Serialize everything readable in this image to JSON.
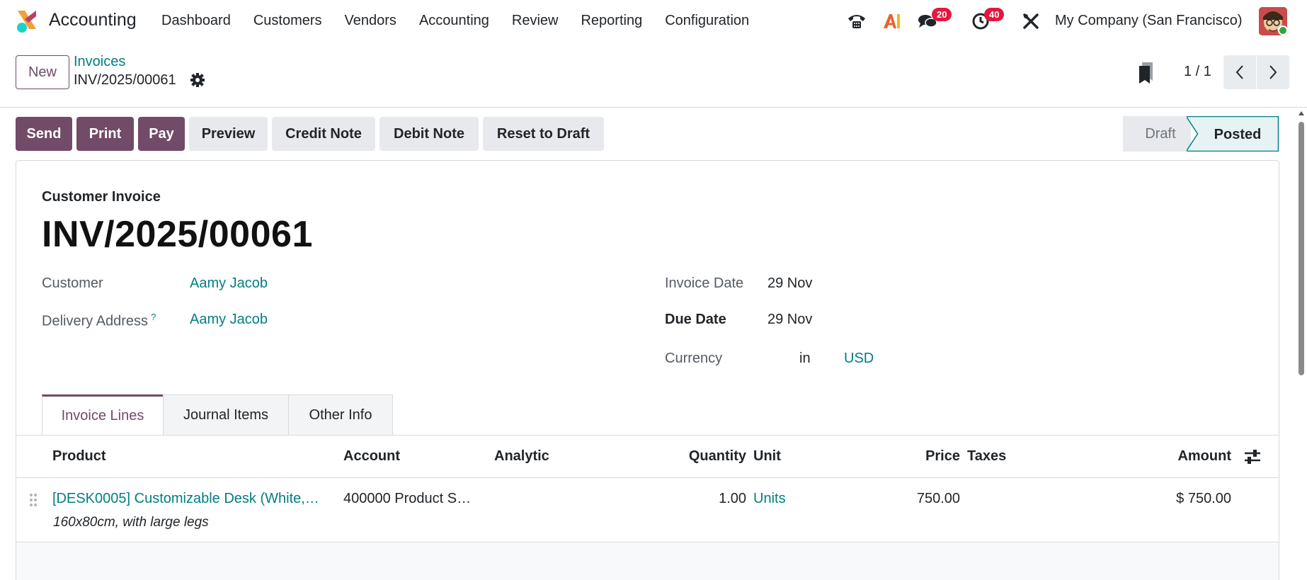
{
  "app": {
    "name": "Accounting"
  },
  "menu": [
    "Dashboard",
    "Customers",
    "Vendors",
    "Accounting",
    "Review",
    "Reporting",
    "Configuration"
  ],
  "systray": {
    "messages_count": "20",
    "activities_count": "40",
    "company": "My Company (San Francisco)",
    "icons": [
      "phone-icon",
      "ai-icon",
      "chat-icon",
      "clock-icon",
      "tools-icon"
    ]
  },
  "control": {
    "new_label": "New",
    "breadcrumb_parent": "Invoices",
    "breadcrumb_current": "INV/2025/00061",
    "pager": "1 / 1"
  },
  "actions": {
    "send": "Send",
    "print": "Print",
    "pay": "Pay",
    "preview": "Preview",
    "credit_note": "Credit Note",
    "debit_note": "Debit Note",
    "reset_to_draft": "Reset to Draft"
  },
  "status": {
    "draft": "Draft",
    "posted": "Posted",
    "current": "Posted"
  },
  "form": {
    "doc_type": "Customer Invoice",
    "doc_number": "INV/2025/00061",
    "customer_label": "Customer",
    "customer_value": "Aamy Jacob",
    "delivery_label": "Delivery Address",
    "delivery_help": "?",
    "delivery_value": "Aamy Jacob",
    "invoice_date_label": "Invoice Date",
    "invoice_date_value": "29 Nov",
    "due_date_label": "Due Date",
    "due_date_value": "29 Nov",
    "currency_label": "Currency",
    "currency_in": "in",
    "currency_value": "USD"
  },
  "tabs": [
    "Invoice Lines",
    "Journal Items",
    "Other Info"
  ],
  "table": {
    "columns": {
      "product": "Product",
      "account": "Account",
      "analytic": "Analytic",
      "quantity": "Quantity",
      "unit": "Unit",
      "price": "Price",
      "taxes": "Taxes",
      "amount": "Amount"
    },
    "rows": [
      {
        "product": "[DESK0005] Customizable Desk (White,…",
        "description": "160x80cm, with large legs",
        "account": "400000 Product S…",
        "analytic": "",
        "quantity": "1.00",
        "unit": "Units",
        "price": "750.00",
        "taxes": "",
        "amount": "$ 750.00"
      }
    ]
  },
  "colors": {
    "primary": "#714b67",
    "link": "#017e84",
    "badge": "#e2173f"
  }
}
